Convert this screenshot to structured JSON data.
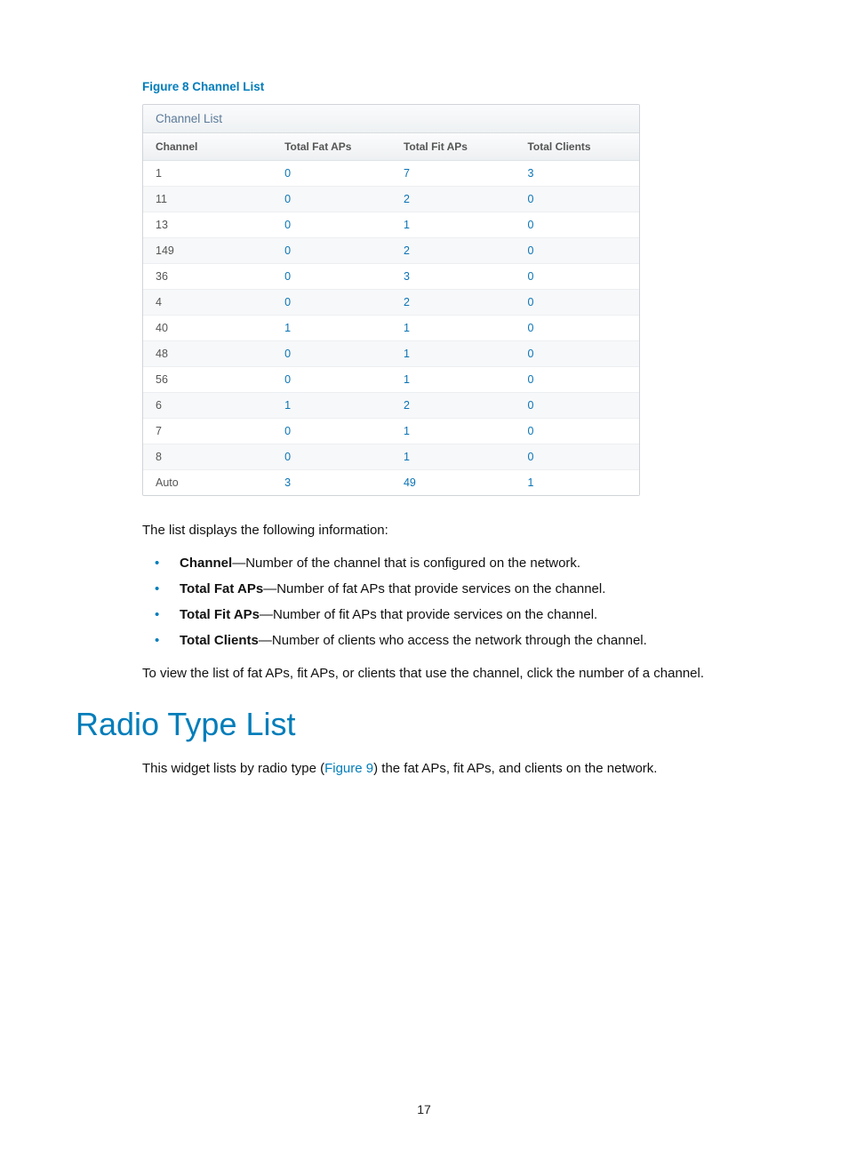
{
  "figure_caption": "Figure 8 Channel List",
  "widget": {
    "title": "Channel List",
    "headers": {
      "channel": "Channel",
      "fat": "Total Fat APs",
      "fit": "Total Fit APs",
      "clients": "Total Clients"
    },
    "rows": [
      {
        "channel": "1",
        "fat": "0",
        "fit": "7",
        "clients": "3"
      },
      {
        "channel": "11",
        "fat": "0",
        "fit": "2",
        "clients": "0"
      },
      {
        "channel": "13",
        "fat": "0",
        "fit": "1",
        "clients": "0"
      },
      {
        "channel": "149",
        "fat": "0",
        "fit": "2",
        "clients": "0"
      },
      {
        "channel": "36",
        "fat": "0",
        "fit": "3",
        "clients": "0"
      },
      {
        "channel": "4",
        "fat": "0",
        "fit": "2",
        "clients": "0"
      },
      {
        "channel": "40",
        "fat": "1",
        "fit": "1",
        "clients": "0"
      },
      {
        "channel": "48",
        "fat": "0",
        "fit": "1",
        "clients": "0"
      },
      {
        "channel": "56",
        "fat": "0",
        "fit": "1",
        "clients": "0"
      },
      {
        "channel": "6",
        "fat": "1",
        "fit": "2",
        "clients": "0"
      },
      {
        "channel": "7",
        "fat": "0",
        "fit": "1",
        "clients": "0"
      },
      {
        "channel": "8",
        "fat": "0",
        "fit": "1",
        "clients": "0"
      },
      {
        "channel": "Auto",
        "fat": "3",
        "fit": "49",
        "clients": "1"
      }
    ]
  },
  "intro_text": "The list displays the following information:",
  "bullets": [
    {
      "term": "Channel",
      "desc": "—Number of the channel that is configured on the network."
    },
    {
      "term": "Total Fat APs",
      "desc": "—Number of fat APs that provide services on the channel."
    },
    {
      "term": "Total Fit APs",
      "desc": "—Number of fit APs that provide services on the channel."
    },
    {
      "term": "Total Clients",
      "desc": "—Number of clients who access the network through the channel."
    }
  ],
  "outro_text": "To view the list of fat APs, fit APs, or clients that use the channel, click the number of a channel.",
  "section_heading": "Radio Type List",
  "section_body_pre": "This widget lists by radio type (",
  "section_body_link": "Figure 9",
  "section_body_post": ") the fat APs, fit APs, and clients on the network.",
  "page_number": "17"
}
